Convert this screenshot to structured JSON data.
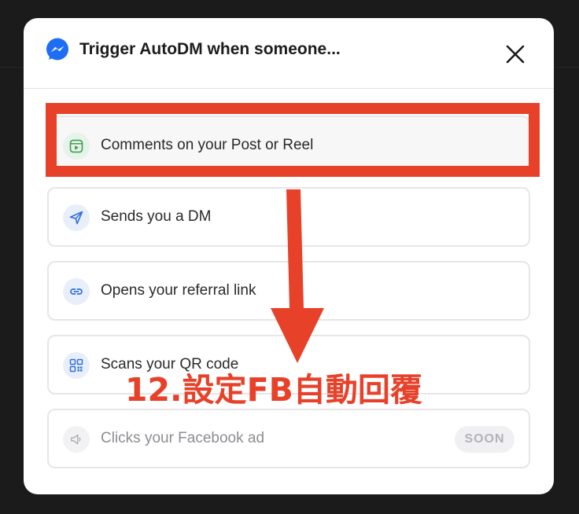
{
  "modal": {
    "title": "Trigger AutoDM when someone...",
    "options": [
      {
        "label": "Comments on your Post or Reel",
        "icon": "reel-icon",
        "selected": true,
        "disabled": false
      },
      {
        "label": "Sends you a DM",
        "icon": "send-icon",
        "selected": false,
        "disabled": false
      },
      {
        "label": "Opens your referral link",
        "icon": "link-icon",
        "selected": false,
        "disabled": false
      },
      {
        "label": "Scans your QR code",
        "icon": "qr-code-icon",
        "selected": false,
        "disabled": false
      },
      {
        "label": "Clicks your Facebook ad",
        "icon": "megaphone-icon",
        "selected": false,
        "disabled": true,
        "badge": "SOON"
      }
    ]
  },
  "annotation": {
    "text": "12.設定FB自動回覆",
    "color": "#e8412a"
  },
  "colors": {
    "messenger_blue": "#1e6df5",
    "reel_green": "#3a9a4f",
    "action_blue": "#2f6fde"
  }
}
